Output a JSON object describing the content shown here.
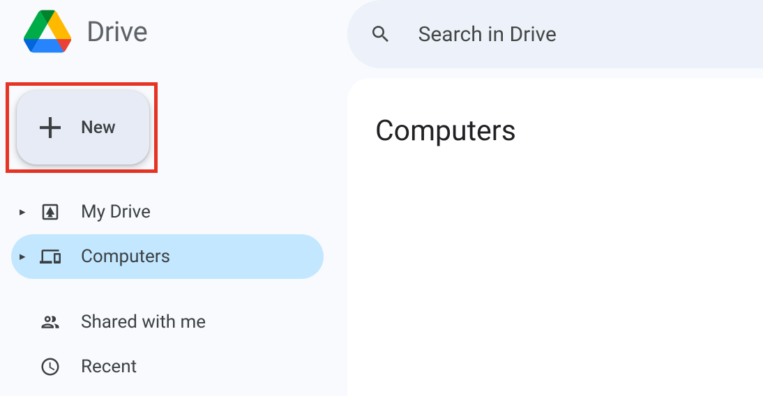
{
  "app": {
    "title": "Drive"
  },
  "search": {
    "placeholder": "Search in Drive"
  },
  "new_button": {
    "label": "New",
    "highlighted": true
  },
  "sidebar": {
    "items": [
      {
        "label": "My Drive",
        "icon": "drive-icon",
        "expandable": true,
        "active": false
      },
      {
        "label": "Computers",
        "icon": "computers-icon",
        "expandable": true,
        "active": true
      },
      {
        "label": "Shared with me",
        "icon": "shared-icon",
        "expandable": false,
        "active": false
      },
      {
        "label": "Recent",
        "icon": "recent-icon",
        "expandable": false,
        "active": false
      }
    ]
  },
  "main": {
    "title": "Computers"
  }
}
